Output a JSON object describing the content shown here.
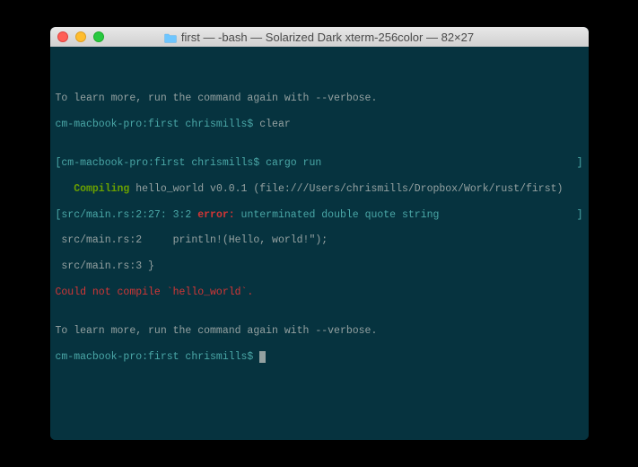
{
  "window": {
    "title": "first — -bash — Solarized Dark xterm-256color — 82×27"
  },
  "terminal": {
    "line1": "To learn more, run the command again with --verbose.",
    "prompt1_host": "cm-macbook-pro:first chrismills$ ",
    "prompt1_cmd": "clear",
    "blank1": "",
    "line2_left": "[cm-macbook-pro:first chrismills$ cargo run",
    "line2_right": "]",
    "compile_label": "   Compiling",
    "compile_text": " hello_world v0.0.1 (file:///Users/chrismills/Dropbox/Work/rust/first)",
    "err_loc_left": "[src/main.rs:2:27: 3:2 ",
    "err_label": "error:",
    "err_msg": " unterminated double quote string",
    "err_right": "]",
    "src_line1": " src/main.rs:2     println!(Hello, world!\");",
    "src_line2": " src/main.rs:3 }",
    "fail_msg": "Could not compile `hello_world`.",
    "blank2": "",
    "line_again": "To learn more, run the command again with --verbose.",
    "prompt2_host": "cm-macbook-pro:first chrismills$ "
  },
  "colors": {
    "bg": "#06333f",
    "text": "#94a1a1",
    "teal": "#4aa7a7",
    "green": "#6aa000",
    "red": "#d23636"
  }
}
